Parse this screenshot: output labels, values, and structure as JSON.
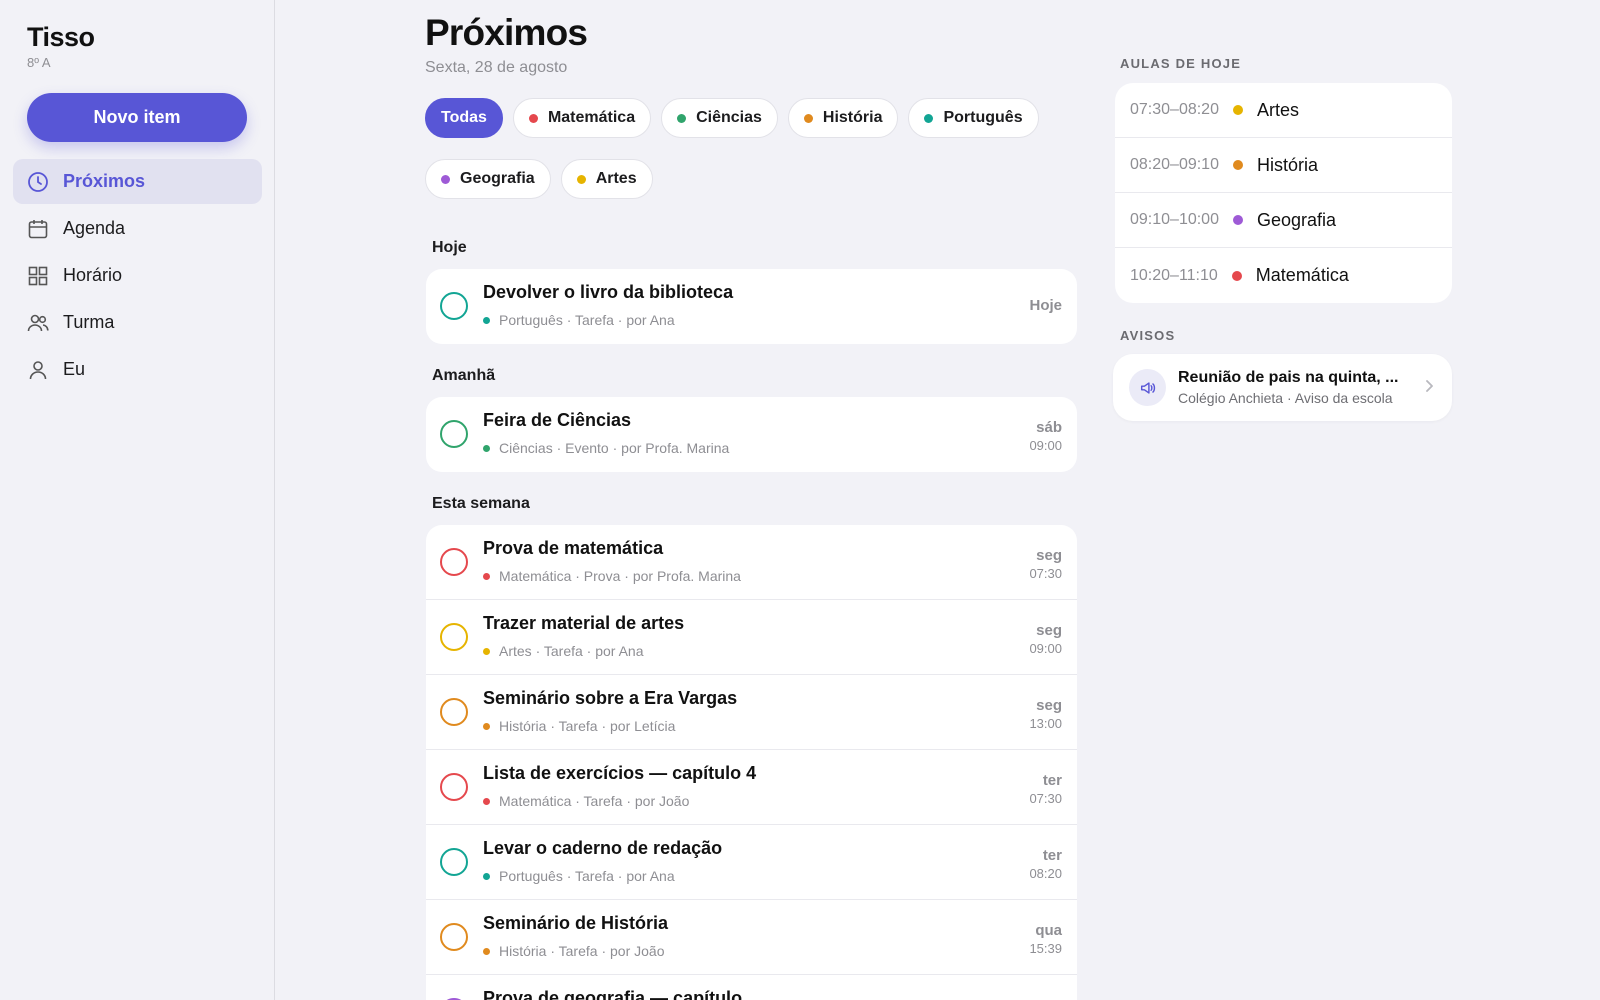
{
  "app": {
    "name": "Tisso",
    "class": "8º A"
  },
  "sidebar": {
    "new_button": "Novo item",
    "items": [
      {
        "label": "Próximos",
        "icon": "clock-icon",
        "active": true
      },
      {
        "label": "Agenda",
        "icon": "calendar-icon",
        "active": false
      },
      {
        "label": "Horário",
        "icon": "grid-icon",
        "active": false
      },
      {
        "label": "Turma",
        "icon": "people-icon",
        "active": false
      },
      {
        "label": "Eu",
        "icon": "person-icon",
        "active": false
      }
    ]
  },
  "header": {
    "title": "Próximos",
    "date": "Sexta, 28 de agosto"
  },
  "filters": [
    {
      "label": "Todas",
      "active": true
    },
    {
      "label": "Matemática",
      "color": "#e5484d"
    },
    {
      "label": "Ciências",
      "color": "#30a46c"
    },
    {
      "label": "História",
      "color": "#e08a1e"
    },
    {
      "label": "Português",
      "color": "#12a594"
    },
    {
      "label": "Geografia",
      "color": "#9e5ad6"
    },
    {
      "label": "Artes",
      "color": "#e6b400"
    }
  ],
  "sections": [
    {
      "label": "Hoje",
      "items": [
        {
          "title": "Devolver o livro da biblioteca",
          "meta": "Português · Tarefa · por Ana",
          "color": "#12a594",
          "day": "Hoje",
          "time": ""
        }
      ]
    },
    {
      "label": "Amanhã",
      "items": [
        {
          "title": "Feira de Ciências",
          "meta": "Ciências · Evento · por Profa. Marina",
          "color": "#30a46c",
          "day": "sáb",
          "time": "09:00"
        }
      ]
    },
    {
      "label": "Esta semana",
      "items": [
        {
          "title": "Prova de matemática",
          "meta": "Matemática · Prova · por Profa. Marina",
          "color": "#e5484d",
          "day": "seg",
          "time": "07:30"
        },
        {
          "title": "Trazer material de artes",
          "meta": "Artes · Tarefa · por Ana",
          "color": "#e6b400",
          "day": "seg",
          "time": "09:00"
        },
        {
          "title": "Seminário sobre a Era Vargas",
          "meta": "História · Tarefa · por Letícia",
          "color": "#e08a1e",
          "day": "seg",
          "time": "13:00"
        },
        {
          "title": "Lista de exercícios — capítulo 4",
          "meta": "Matemática · Tarefa · por João",
          "color": "#e5484d",
          "day": "ter",
          "time": "07:30"
        },
        {
          "title": "Levar o caderno de redação",
          "meta": "Português · Tarefa · por Ana",
          "color": "#12a594",
          "day": "ter",
          "time": "08:20"
        },
        {
          "title": "Seminário de História",
          "meta": "História · Tarefa · por João",
          "color": "#e08a1e",
          "day": "qua",
          "time": "15:39"
        },
        {
          "title": "Prova de geografia — capítulo",
          "meta": "",
          "color": "#9e5ad6",
          "day": "",
          "time": ""
        }
      ]
    }
  ],
  "today_classes": {
    "label": "AULAS DE HOJE",
    "items": [
      {
        "time": "07:30–08:20",
        "subject": "Artes",
        "color": "#e6b400"
      },
      {
        "time": "08:20–09:10",
        "subject": "História",
        "color": "#e08a1e"
      },
      {
        "time": "09:10–10:00",
        "subject": "Geografia",
        "color": "#9e5ad6"
      },
      {
        "time": "10:20–11:10",
        "subject": "Matemática",
        "color": "#e5484d"
      }
    ]
  },
  "notices": {
    "label": "AVISOS",
    "items": [
      {
        "title": "Reunião de pais na quinta, ...",
        "subtitle": "Colégio Anchieta · Aviso da escola",
        "icon": "megaphone-icon"
      }
    ]
  }
}
